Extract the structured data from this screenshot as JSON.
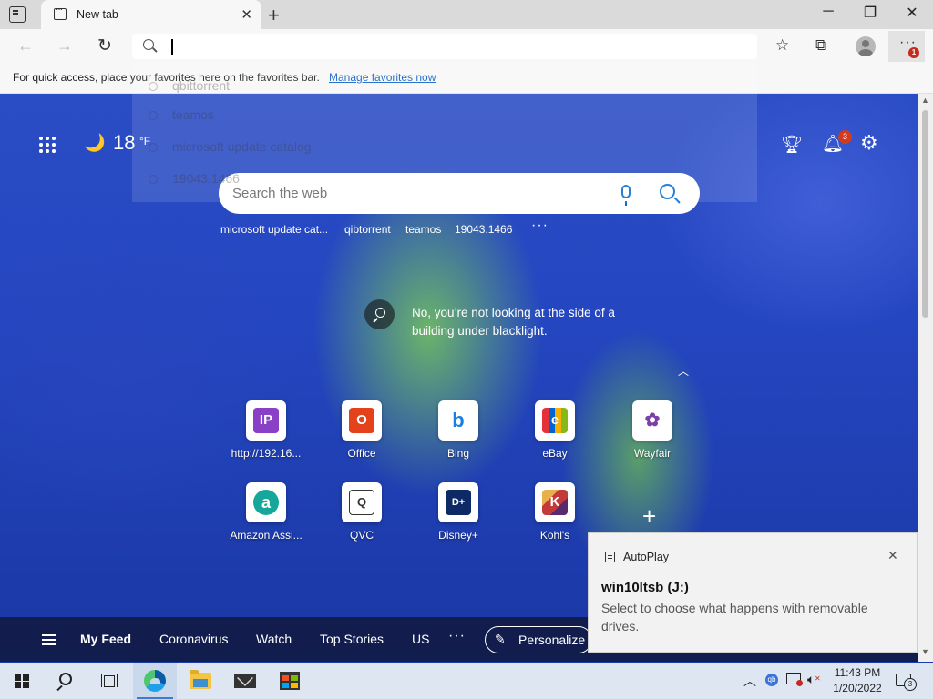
{
  "browser": {
    "tab_title": "New tab",
    "address_value": "",
    "favorites_message": "For quick access, place your favorites here on the favorites bar.",
    "favorites_link": "Manage favorites now",
    "menu_badge": "1"
  },
  "omnibox_dropdown": {
    "items": [
      "qbittorrent",
      "teamos",
      "microsoft update catalog",
      "19043.1466"
    ]
  },
  "newtab": {
    "weather_temp": "18",
    "weather_unit": "°F",
    "notification_count": "3",
    "search_placeholder": "Search the web",
    "recent_searches": [
      "microsoft update cat...",
      "qibtorrent",
      "teamos",
      "19043.1466"
    ],
    "more_label": "···",
    "image_caption": "No, you’re not looking at the side of a building under blacklight.",
    "tiles": [
      {
        "label": "http://192.16...",
        "icon": "ip-icon",
        "glyph": "IP",
        "color": "#8a3fc7"
      },
      {
        "label": "Office",
        "icon": "office-icon",
        "glyph": "O",
        "color": "#e3421b"
      },
      {
        "label": "Bing",
        "icon": "bing-icon",
        "glyph": "b",
        "color": "#1a7fe0"
      },
      {
        "label": "eBay",
        "icon": "ebay-icon",
        "glyph": "e",
        "color": "#333333"
      },
      {
        "label": "Wayfair",
        "icon": "wayfair-icon",
        "glyph": "✿",
        "color": "#7b3fa6"
      },
      {
        "label": "Amazon Assi...",
        "icon": "amazon-assistant-icon",
        "glyph": "a",
        "color": "#15a89a"
      },
      {
        "label": "QVC",
        "icon": "qvc-icon",
        "glyph": "Q",
        "color": "#ffffff"
      },
      {
        "label": "Disney+",
        "icon": "disney-plus-icon",
        "glyph": "D+",
        "color": "#0d2a66"
      },
      {
        "label": "Kohl's",
        "icon": "kohls-icon",
        "glyph": "K",
        "color": "#7a1f3d"
      }
    ],
    "feed": {
      "items": [
        "My Feed",
        "Coronavirus",
        "Watch",
        "Top Stories",
        "US"
      ],
      "more": "···",
      "personalize": "Personalize"
    }
  },
  "toast": {
    "app": "AutoPlay",
    "title": "win10ltsb (J:)",
    "body": "Select to choose what happens with removable drives."
  },
  "taskbar": {
    "time": "11:43 PM",
    "date": "1/20/2022",
    "action_center_count": "3"
  },
  "colors": {
    "accent": "#0b6fcf",
    "link": "#0b5fc4",
    "badge": "#d33b1f"
  }
}
